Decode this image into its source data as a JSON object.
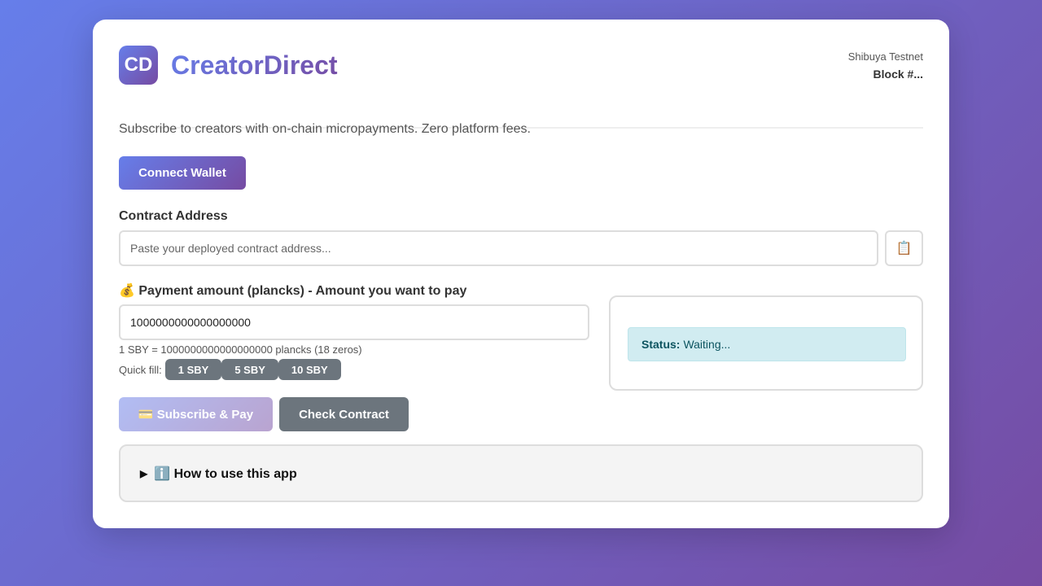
{
  "header": {
    "logo_text": "CD",
    "app_title": "CreatorDirect",
    "network_name": "Shibuya Testnet",
    "block_number": "Block #..."
  },
  "tagline": "Subscribe to creators with on-chain micropayments. Zero platform fees.",
  "wallet": {
    "connect_label": "Connect Wallet"
  },
  "contract": {
    "label": "Contract Address",
    "placeholder": "Paste your deployed contract address...",
    "value": "",
    "paste_icon": "clipboard-icon"
  },
  "payment": {
    "label": "💰 Payment amount (plancks) - Amount you want to pay",
    "value": "1000000000000000000",
    "hint": "1 SBY = 1000000000000000000 plancks (18 zeros)",
    "quickfill_label": "Quick fill:",
    "quickfill_options": [
      "1 SBY",
      "5 SBY",
      "10 SBY"
    ]
  },
  "status": {
    "label": "Status:",
    "value": "Waiting..."
  },
  "actions": {
    "subscribe_label": "💳 Subscribe & Pay",
    "check_label": "Check Contract"
  },
  "howto": {
    "label": "ℹ️ How to use this app"
  },
  "colors": {
    "gradient_start": "#667eea",
    "gradient_end": "#764ba2",
    "status_bg": "#d1ecf1",
    "secondary_button": "#6c757d"
  }
}
